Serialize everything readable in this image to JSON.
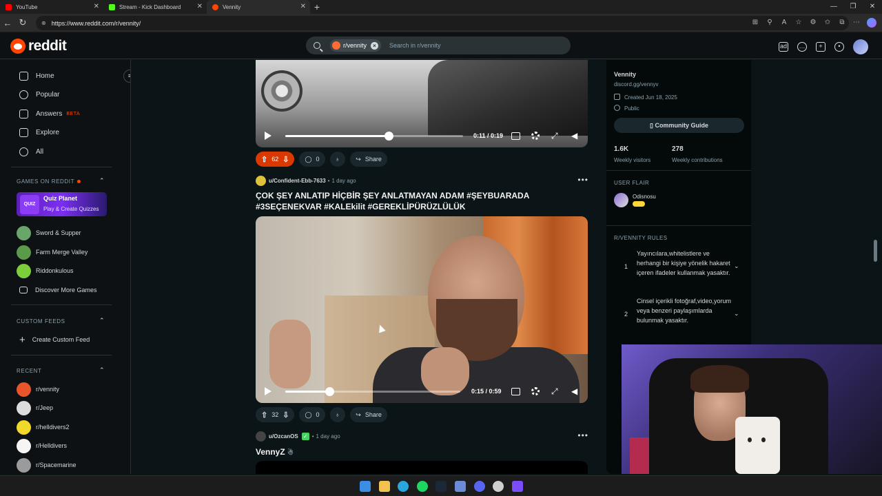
{
  "browser": {
    "tabs": [
      {
        "title": "YouTube",
        "active": false
      },
      {
        "title": "Stream - Kick Dashboard",
        "active": false
      },
      {
        "title": "Vennity",
        "active": true
      }
    ],
    "url": "https://www.reddit.com/r/vennity/"
  },
  "header": {
    "logo_text": "reddit",
    "search_chip": "r/vennity",
    "search_placeholder": "Search in r/vennity"
  },
  "left_nav": {
    "items": [
      {
        "label": "Home"
      },
      {
        "label": "Popular"
      },
      {
        "label": "Answers",
        "badge": "BETA"
      },
      {
        "label": "Explore"
      },
      {
        "label": "All"
      }
    ],
    "games_title": "GAMES ON REDDIT",
    "quiz": {
      "logo": "QUIZ",
      "title": "Quiz Planet",
      "subtitle": "Play & Create Quizzes"
    },
    "games": [
      {
        "label": "Sword & Supper"
      },
      {
        "label": "Farm Merge Valley"
      },
      {
        "label": "Riddonkulous"
      },
      {
        "label": "Discover More Games"
      }
    ],
    "custom_feeds_title": "CUSTOM FEEDS",
    "create_custom_feed": "Create Custom Feed",
    "recent_title": "RECENT",
    "recent": [
      {
        "label": "r/vennity"
      },
      {
        "label": "r/Jeep"
      },
      {
        "label": "r/helldivers2"
      },
      {
        "label": "r/Helldivers"
      },
      {
        "label": "r/Spacemarine"
      }
    ]
  },
  "feed": {
    "post1": {
      "video_time": "0:11 / 0:19",
      "video_progress": 0.58,
      "votes": "62",
      "comments": "0",
      "share": "Share"
    },
    "post2": {
      "author": "u/Confident-Ebb-7633",
      "age": "1 day ago",
      "title": "ÇOK ŞEY ANLATIP HİÇBİR ŞEY ANLATMAYAN ADAM #ŞEYBUARADA #3SEÇENEKVAR #KALEkilit #GEREKLİPÜRÜZLÜLÜK",
      "video_time": "0:15 / 0:59",
      "video_progress": 0.25,
      "votes": "32",
      "comments": "0",
      "share": "Share"
    },
    "post3": {
      "author": "u/OzcanOS",
      "age": "1 day ago",
      "title": "VennyZ"
    }
  },
  "right_sidebar": {
    "community_name": "Vennity",
    "link": "discord.gg/vennyv",
    "created": "Created Jun 18, 2025",
    "visibility": "Public",
    "guide_button": "Community Guide",
    "stats": [
      {
        "value": "1.6K",
        "label": "Weekly visitors"
      },
      {
        "value": "278",
        "label": "Weekly contributions"
      }
    ],
    "user_flair_title": "USER FLAIR",
    "flair_user": "Odisnosu",
    "rules_title": "R/VENNITY RULES",
    "rules": [
      {
        "num": "1",
        "text": "Yayıncılara,whitelistlere ve herhangi bir kişiye yönelik hakaret içeren ifadeler kullanmak yasaktır."
      },
      {
        "num": "2",
        "text": "Cinsel içerikli fotoğraf,video,yorum veya benzeri paylaşımlarda bulunmak yasaktır."
      }
    ]
  },
  "colors": {
    "reddit_orange": "#ff4500",
    "upvoted_pill": "#d93900",
    "background": "#0b1416"
  }
}
